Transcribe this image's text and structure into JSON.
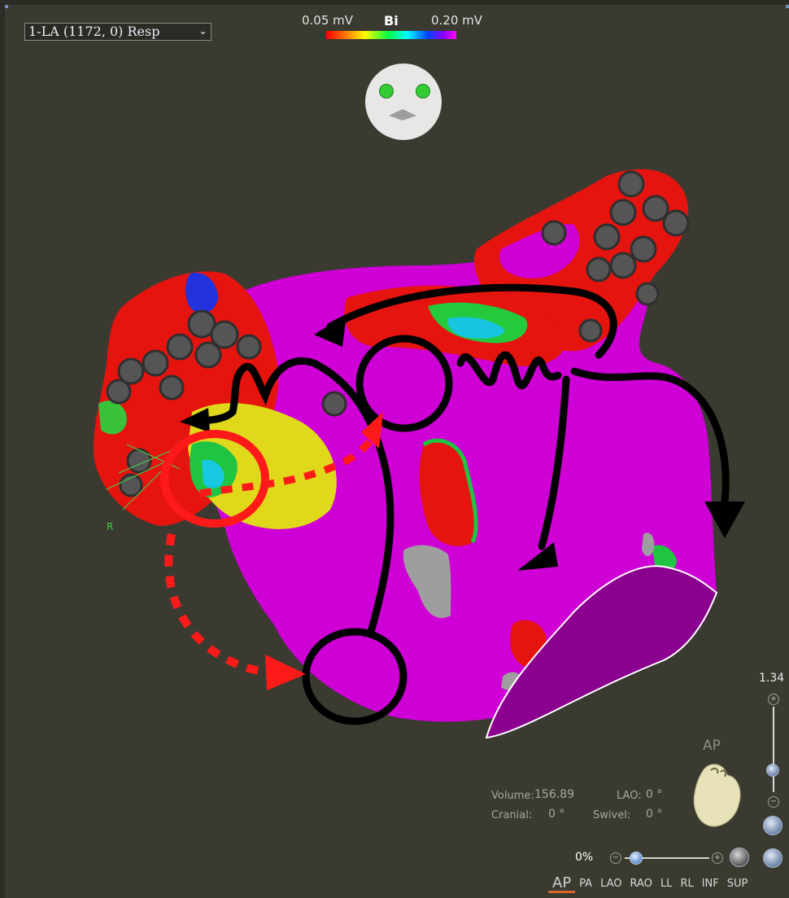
{
  "map_selector": {
    "value": "1-LA (1172, 0) Resp"
  },
  "color_scale": {
    "min_label": "0.05 mV",
    "type": "Bi",
    "max_label": "0.20 mV"
  },
  "orientation_marker": {
    "label": "R"
  },
  "info": {
    "volume_label": "Volume:",
    "volume_value": "156.89",
    "lao_label": "LAO:",
    "lao_value": "0 °",
    "cranial_label": "Cranial:",
    "cranial_value": "0 °",
    "swivel_label": "Swivel:",
    "swivel_value": "0 °"
  },
  "zoom": {
    "level": "1.34",
    "plus": "+",
    "minus": "−",
    "slider_fraction": 0.2
  },
  "view": {
    "current": "AP"
  },
  "opacity": {
    "value": "0%",
    "minus": "−",
    "plus": "+"
  },
  "view_tabs": [
    "AP",
    "PA",
    "LAO",
    "RAO",
    "LL",
    "RL",
    "INF",
    "SUP"
  ],
  "colors": {
    "background": "#3b3a31",
    "map_magenta": "#d400d8",
    "arrow_black": "#000000",
    "arrow_red": "#ff1a1a",
    "tab_accent": "#d9662a"
  }
}
